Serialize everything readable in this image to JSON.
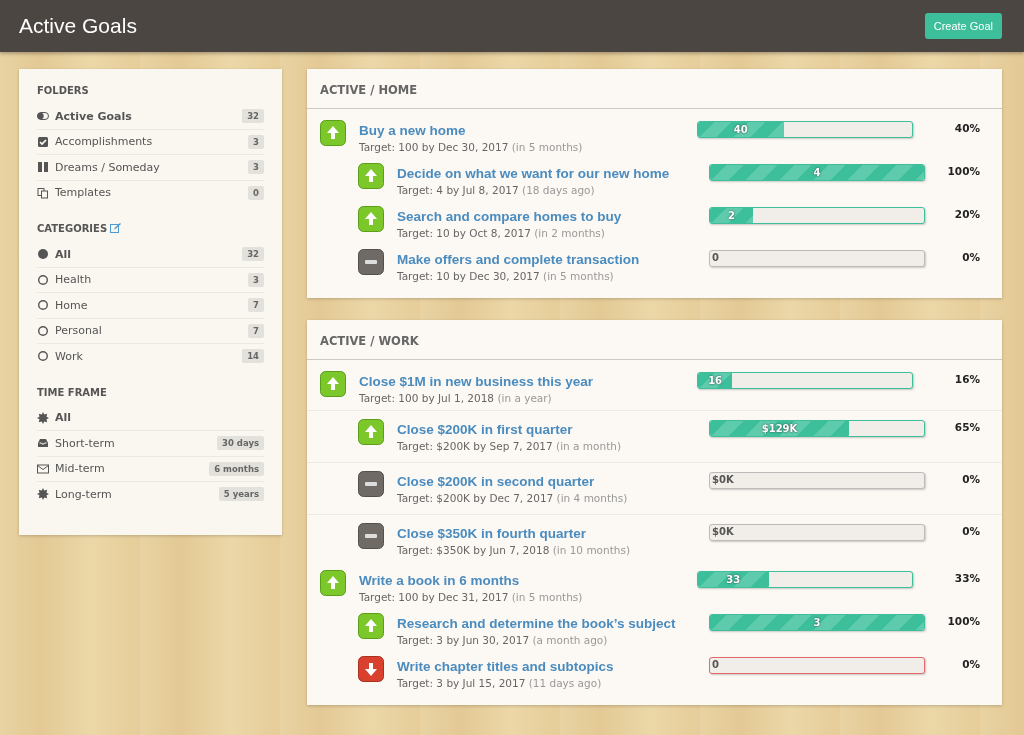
{
  "header": {
    "title": "Active Goals",
    "button": "Create Goal"
  },
  "sidebar": [
    {
      "heading": "FOLDERS",
      "editable": false,
      "items": [
        {
          "kind": "toggle",
          "label": "Active Goals",
          "count": "32",
          "selected": true
        },
        {
          "kind": "checkbox",
          "label": "Accomplishments",
          "count": "3",
          "selected": false
        },
        {
          "kind": "pause",
          "label": "Dreams / Someday",
          "count": "3",
          "selected": false
        },
        {
          "kind": "copy",
          "label": "Templates",
          "count": "0",
          "selected": false
        }
      ]
    },
    {
      "heading": "CATEGORIES",
      "editable": true,
      "items": [
        {
          "kind": "radio",
          "label": "All",
          "count": "32",
          "selected": true
        },
        {
          "kind": "radio",
          "label": "Health",
          "count": "3",
          "selected": false
        },
        {
          "kind": "radio",
          "label": "Home",
          "count": "7",
          "selected": false
        },
        {
          "kind": "radio",
          "label": "Personal",
          "count": "7",
          "selected": false
        },
        {
          "kind": "radio",
          "label": "Work",
          "count": "14",
          "selected": false
        }
      ]
    },
    {
      "heading": "TIME FRAME",
      "editable": false,
      "items": [
        {
          "kind": "burst",
          "label": "All",
          "selected": true
        },
        {
          "kind": "tray",
          "label": "Short-term",
          "count": "30 days",
          "selected": false
        },
        {
          "kind": "envelope",
          "label": "Mid-term",
          "count": "6 months",
          "selected": false
        },
        {
          "kind": "burst",
          "label": "Long-term",
          "count": "5 years",
          "selected": false
        }
      ]
    }
  ],
  "sections": [
    {
      "title": "ACTIVE / HOME",
      "goals": [
        {
          "kind": "up",
          "title": "Buy a new home",
          "target": "Target: 100 by Dec 30, 2017",
          "due": "(in 5 months)",
          "level": 0.4,
          "bar_label": "40",
          "percent": "40%",
          "children": [
            {
              "kind": "up",
              "title": "Decide on what we want for our new home",
              "target": "Target: 4 by Jul 8, 2017",
              "due": "(18 days ago)",
              "level": 1,
              "bar_label": "4",
              "percent": "100%"
            },
            {
              "kind": "up",
              "title": "Search and compare homes to buy",
              "target": "Target: 10 by Oct 8, 2017",
              "due": "(in 2 months)",
              "level": 0.2,
              "bar_label": "2",
              "percent": "20%"
            },
            {
              "kind": "neutral",
              "title": "Make offers and complete transaction",
              "target": "Target: 10 by Dec 30, 2017",
              "due": "(in 5 months)",
              "level": 0,
              "bar_label": "0",
              "percent": "0%"
            }
          ]
        }
      ]
    },
    {
      "title": "ACTIVE / WORK",
      "goals": [
        {
          "kind": "up",
          "title": "Close $1M in new business this year",
          "target": "Target: 100 by Jul 1, 2018",
          "due": "(in a year)",
          "level": 0.16,
          "bar_label": "16",
          "percent": "16%",
          "children": [
            {
              "kind": "up",
              "title": "Close $200K in first quarter",
              "target": "Target: $200K by Sep 7, 2017",
              "due": "(in a month)",
              "level": 0.65,
              "bar_label": "$129K",
              "percent": "65%"
            },
            {
              "kind": "neutral",
              "title": "Close $200K in second quarter",
              "target": "Target: $200K by Dec 7, 2017",
              "due": "(in 4 months)",
              "level": 0,
              "bar_label": "$0K",
              "percent": "0%"
            },
            {
              "kind": "neutral",
              "title": "Close $350K in fourth quarter",
              "target": "Target: $350K by Jun 7, 2018",
              "due": "(in 10 months)",
              "level": 0,
              "bar_label": "$0K",
              "percent": "0%"
            }
          ]
        },
        {
          "kind": "up",
          "title": "Write a book in 6 months",
          "target": "Target: 100 by Dec 31, 2017",
          "due": "(in 5 months)",
          "level": 0.33,
          "bar_label": "33",
          "percent": "33%",
          "children": [
            {
              "kind": "up",
              "title": "Research and determine the book’s subject",
              "target": "Target: 3 by Jun 30, 2017",
              "due": "(a month ago)",
              "level": 1,
              "bar_label": "3",
              "percent": "100%"
            },
            {
              "kind": "down",
              "title": "Write chapter titles and subtopics",
              "target": "Target: 3 by Jul 15, 2017",
              "due": "(11 days ago)",
              "level": 0,
              "bar_label": "0",
              "percent": "0%"
            }
          ]
        }
      ]
    }
  ]
}
